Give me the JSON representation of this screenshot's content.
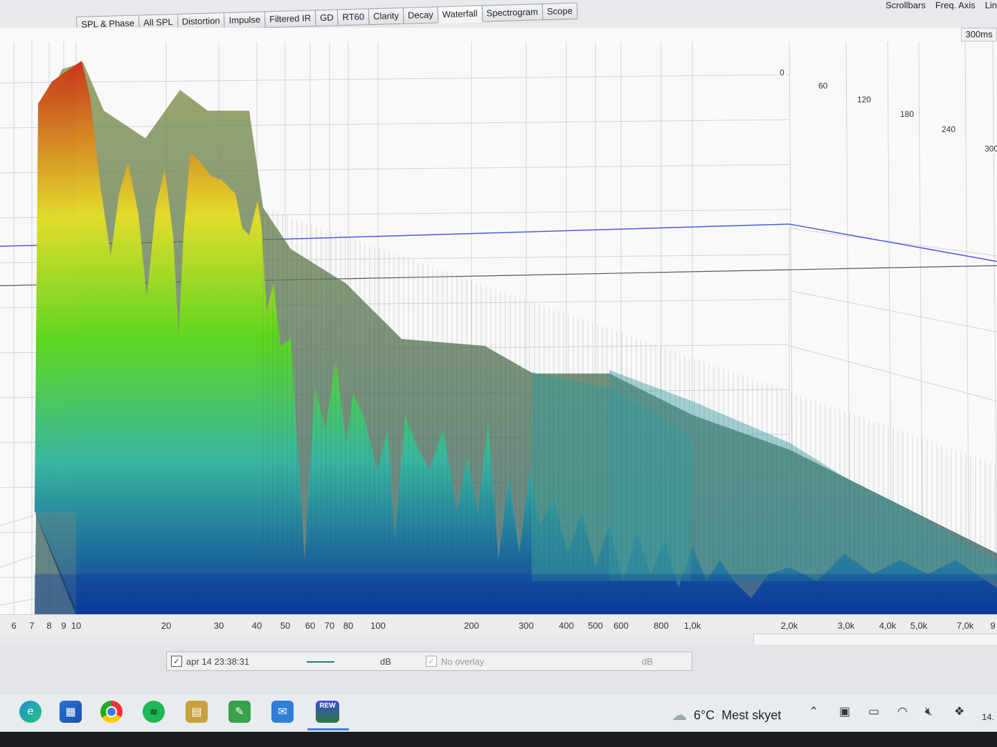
{
  "tabs": [
    {
      "label": "SPL & Phase",
      "active": false
    },
    {
      "label": "All SPL",
      "active": false
    },
    {
      "label": "Distortion",
      "active": false
    },
    {
      "label": "Impulse",
      "active": false
    },
    {
      "label": "Filtered IR",
      "active": false
    },
    {
      "label": "GD",
      "active": false
    },
    {
      "label": "RT60",
      "active": false
    },
    {
      "label": "Clarity",
      "active": false
    },
    {
      "label": "Decay",
      "active": false
    },
    {
      "label": "Waterfall",
      "active": true
    },
    {
      "label": "Spectrogram",
      "active": false
    },
    {
      "label": "Scope",
      "active": false
    }
  ],
  "toolbar_right": {
    "scrollbars": "Scrollbars",
    "freq_axis": "Freq. Axis",
    "lin": "Lin"
  },
  "graph": {
    "time_range": "300ms",
    "time_labels": [
      "0",
      "60",
      "120",
      "180",
      "240",
      "300"
    ],
    "freq_labels": [
      "6",
      "7",
      "8",
      "9",
      "10",
      "20",
      "30",
      "40",
      "50",
      "60",
      "70",
      "80",
      "100",
      "200",
      "300",
      "400",
      "500",
      "600",
      "800",
      "1,0k",
      "2,0k",
      "3,0k",
      "4,0k",
      "5,0k",
      "7,0k",
      "9"
    ],
    "colors": {
      "peak_red": "#c8361c",
      "yellow": "#e2dc2c",
      "green": "#5ed620",
      "teal": "#38b6a0",
      "deep_blue": "#0c3a9c",
      "ref_line": "#4a58d8"
    }
  },
  "legend": {
    "measurement_checked": true,
    "measurement_name": "apr 14 23:38:31",
    "unit1": "dB",
    "overlay_checked": true,
    "overlay_label": "No overlay",
    "unit2": "dB"
  },
  "taskbar": {
    "icons": [
      "edge-icon",
      "store-icon",
      "chrome-icon",
      "spotify-icon",
      "notes-icon",
      "app-icon",
      "mail-icon",
      "rew-icon"
    ],
    "rew_label": "REW",
    "weather_temp": "6°C",
    "weather_text": "Mest skyet",
    "clock_fragment": "14."
  }
}
